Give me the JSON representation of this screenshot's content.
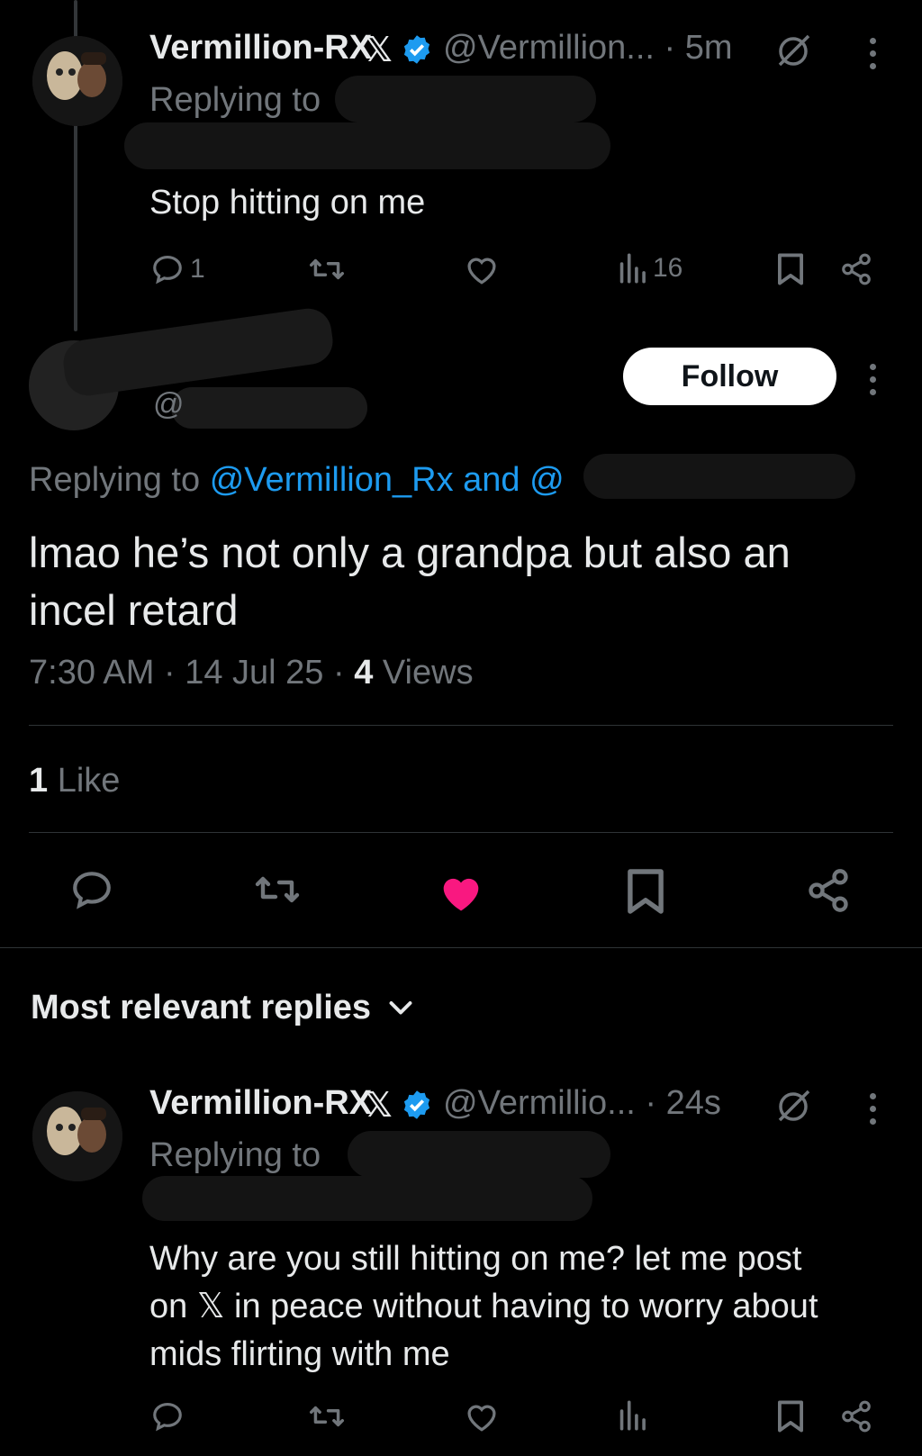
{
  "tweet1": {
    "name": "Vermillion-RX",
    "handle": "@Vermillion... · 5m",
    "replying_to": "Replying to",
    "text": "Stop hitting on me",
    "reply_count": "1",
    "views": "16"
  },
  "tweet2": {
    "follow_label": "Follow",
    "replying_prefix": "Replying to",
    "replying_handle": "@Vermillion_Rx and @",
    "text_line1": "lmao he’s not only a grandpa but also an",
    "text_line2": "incel retard",
    "time": "7:30 AM · 14 Jul 25 · ",
    "views_count": "4",
    "views_label": " Views",
    "likes_count": "1",
    "likes_label": " Like",
    "liked": true
  },
  "replies_header": {
    "label": "Most relevant replies"
  },
  "tweet3": {
    "name": "Vermillion-RX",
    "handle": "@Vermillio... · 24s",
    "replying_to": "Replying to",
    "text_line1": "Why are you still hitting on me? let me post",
    "text_line2": "on 𝕏 in peace without having to worry about",
    "text_line3": "mids flirting with me"
  },
  "colors": {
    "background": "#000000",
    "text": "#e7e9ea",
    "muted": "#71767b",
    "link": "#1d9bf0",
    "like_active": "#f91880",
    "verified": "#1d9bf0"
  },
  "icons": [
    "verified-badge-icon",
    "x-logo-icon",
    "mute-icon",
    "more-icon",
    "reply-icon",
    "retweet-icon",
    "like-icon",
    "views-icon",
    "bookmark-icon",
    "share-icon",
    "chevron-down-icon"
  ]
}
